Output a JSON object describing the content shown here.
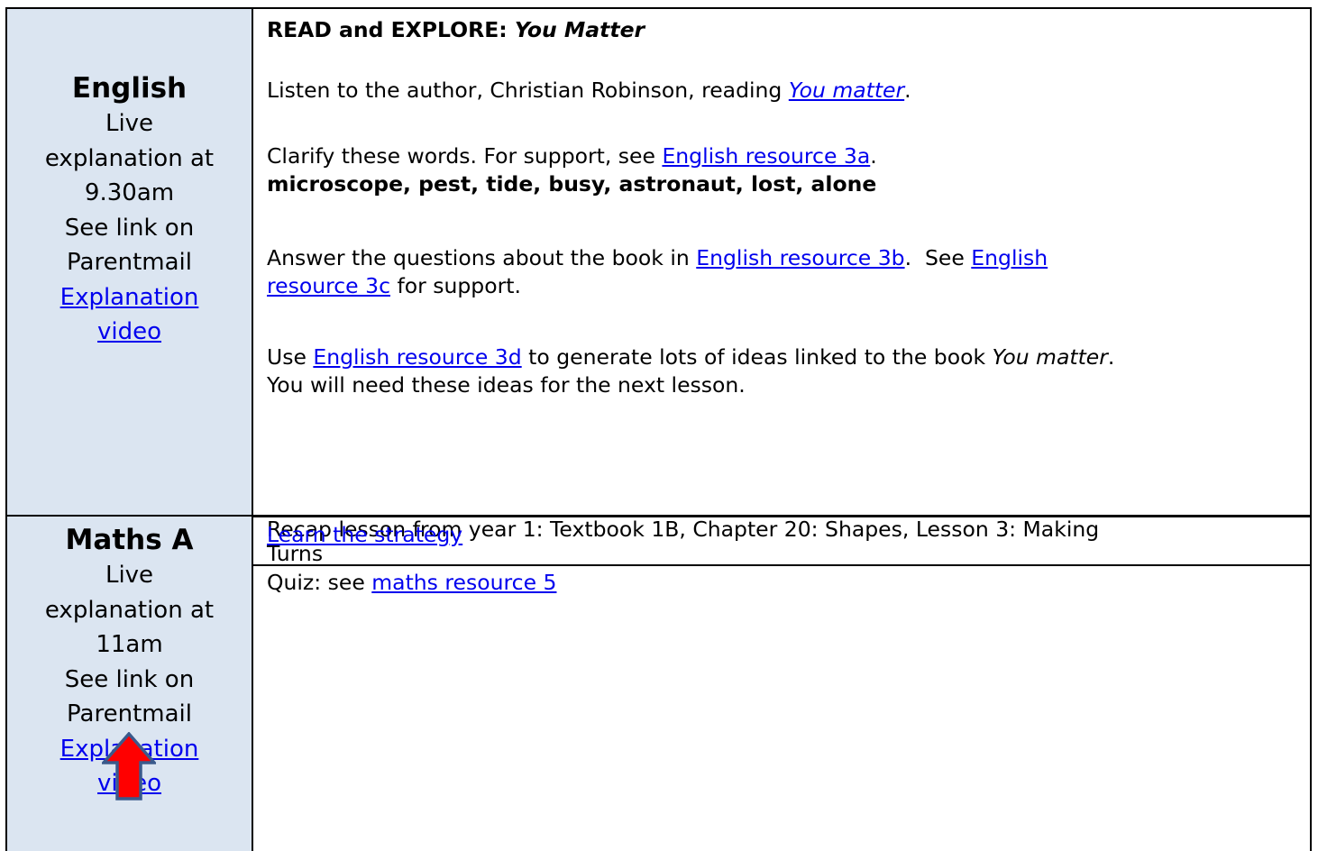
{
  "english": {
    "subject": "English",
    "live_lines": [
      "Live",
      "explanation at",
      "9.30am",
      "See link on",
      "Parentmail"
    ],
    "video_link": [
      "Explanation",
      "video"
    ],
    "heading_prefix": "READ and EXPLORE: ",
    "heading_title": "You Matter",
    "listen_prefix": "Listen to the author, Christian Robinson, reading ",
    "listen_link": "You matter",
    "listen_suffix": ".",
    "clarify_prefix": "Clarify these words. For support, see ",
    "clarify_link": "English resource 3a",
    "clarify_suffix": ".",
    "words": "microscope, pest, tide, busy, astronaut, lost, alone",
    "answer_prefix": "Answer the questions about the book in ",
    "answer_link1": "English resource 3b",
    "answer_mid": ".  See ",
    "answer_link2a": "English",
    "answer_link2b": "resource 3c",
    "answer_suffix": " for support.",
    "use_prefix": "Use ",
    "use_link": "English resource 3d",
    "use_mid": " to generate lots of ideas linked to the book ",
    "use_book": "You matter",
    "use_suffix": ".",
    "use_line2": "You will need these ideas for the next lesson."
  },
  "maths": {
    "subject": "Maths A",
    "live_lines": [
      "Live",
      "explanation at",
      "11am",
      "See link on",
      "Parentmail"
    ],
    "video_link": [
      "Explanation",
      "video"
    ],
    "recap_line1": "Recap lesson from year 1: Textbook 1B, Chapter  20: Shapes, Lesson 3:  Making",
    "recap_line2": "Turns",
    "strategy_link": "Learn the strategy",
    "quiz_prefix": "Quiz: see ",
    "quiz_link": "maths resource 5"
  },
  "colors": {
    "left_fill": "#dbe5f1",
    "link": "#0000ee",
    "arrow_fill": "#ff0000",
    "arrow_stroke": "#3a5a8c"
  },
  "icons": {
    "arrow": "red-up-arrow-icon"
  }
}
